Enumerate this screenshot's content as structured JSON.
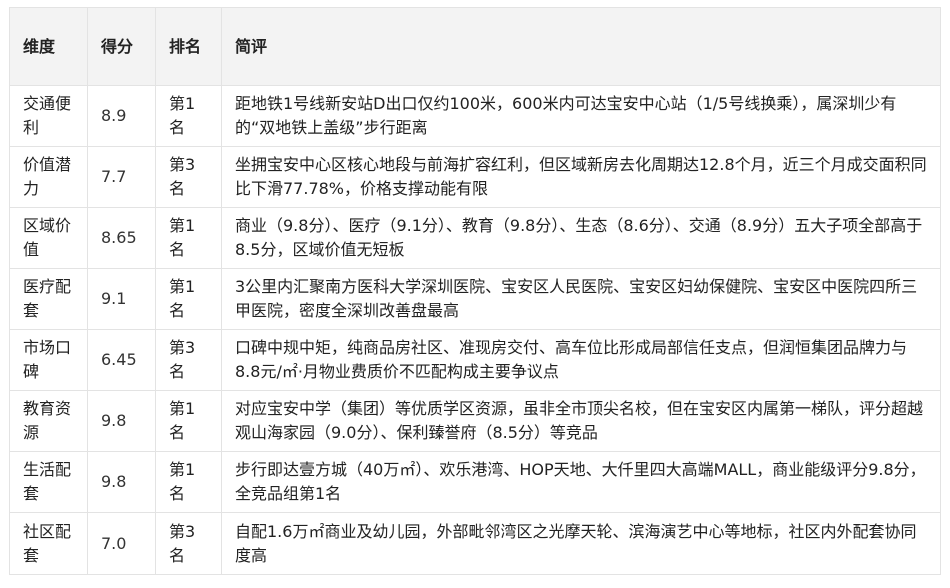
{
  "table": {
    "headers": {
      "dimension": "维度",
      "score": "得分",
      "rank": "排名",
      "comment": "简评"
    },
    "rows": [
      {
        "dimension": "交通便利",
        "score": "8.9",
        "rank": "第1名",
        "comment": "距地铁1号线新安站D出口仅约100米，600米内可达宝安中心站（1/5号线换乘），属深圳少有的“双地铁上盖级”步行距离"
      },
      {
        "dimension": "价值潜力",
        "score": "7.7",
        "rank": "第3名",
        "comment": "坐拥宝安中心区核心地段与前海扩容红利，但区域新房去化周期达12.8个月，近三个月成交面积同比下滑77.78%，价格支撑动能有限"
      },
      {
        "dimension": "区域价值",
        "score": "8.65",
        "rank": "第1名",
        "comment": "商业（9.8分）、医疗（9.1分）、教育（9.8分）、生态（8.6分）、交通（8.9分）五大子项全部高于8.5分，区域价值无短板"
      },
      {
        "dimension": "医疗配套",
        "score": "9.1",
        "rank": "第1名",
        "comment": "3公里内汇聚南方医科大学深圳医院、宝安区人民医院、宝安区妇幼保健院、宝安区中医院四所三甲医院，密度全深圳改善盘最高"
      },
      {
        "dimension": "市场口碑",
        "score": "6.45",
        "rank": "第3名",
        "comment": "口碑中规中矩，纯商品房社区、准现房交付、高车位比形成局部信任支点，但润恒集团品牌力与8.8元/㎡·月物业费质价不匹配构成主要争议点"
      },
      {
        "dimension": "教育资源",
        "score": "9.8",
        "rank": "第1名",
        "comment": "对应宝安中学（集团）等优质学区资源，虽非全市顶尖名校，但在宝安区内属第一梯队，评分超越观山海家园（9.0分）、保利臻誉府（8.5分）等竞品"
      },
      {
        "dimension": "生活配套",
        "score": "9.8",
        "rank": "第1名",
        "comment": "步行即达壹方城（40万㎡）、欢乐港湾、HOP天地、大仟里四大高端MALL，商业能级评分9.8分，全竞品组第1名"
      },
      {
        "dimension": "社区配套",
        "score": "7.0",
        "rank": "第3名",
        "comment": "自配1.6万㎡商业及幼儿园，外部毗邻湾区之光摩天轮、滨海演艺中心等地标，社区内外配套协同度高"
      }
    ]
  }
}
